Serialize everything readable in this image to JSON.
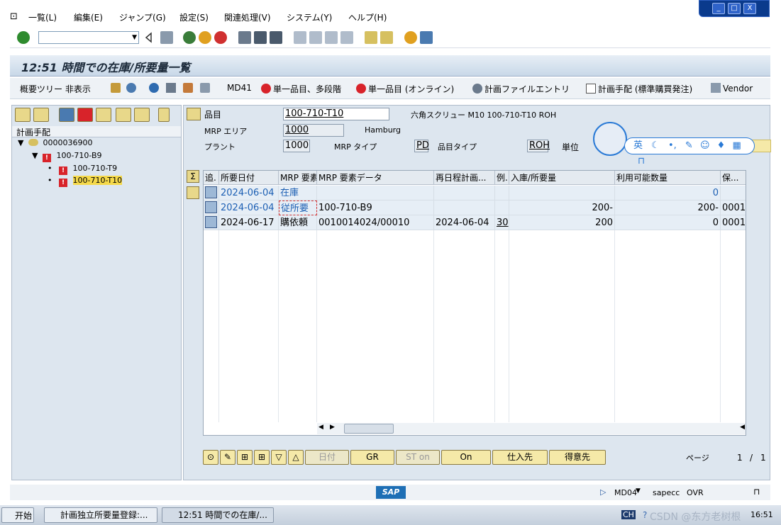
{
  "menubar": [
    "一覧(L)",
    "編集(E)",
    "ジャンプ(G)",
    "設定(S)",
    "関連処理(V)",
    "システム(Y)",
    "ヘルプ(H)"
  ],
  "window_buttons": [
    "_",
    "□",
    "X"
  ],
  "screen_title": "12:51 時間での在庫/所要量一覧",
  "appbar": {
    "hide_tree": "概要ツリー 非表示",
    "md41": "MD41",
    "single_multi": "単一品目、多段階",
    "single_online": "単一品目 (オンライン)",
    "planning_file": "計画ファイルエントリ",
    "planning_std": "計画手配 (標準購買発注)",
    "vendor": "Vendor"
  },
  "tree": {
    "header": "計画手配",
    "nodes": [
      {
        "label": "0000036900",
        "level": 0
      },
      {
        "label": "100-710-B9",
        "level": 1
      },
      {
        "label": "100-710-T9",
        "level": 2
      },
      {
        "label": "100-710-T10",
        "level": 2,
        "selected": true
      }
    ]
  },
  "header": {
    "material_label": "品目",
    "material_value": "100-710-T10",
    "material_desc": "六角スクリュー M10 100-710-T10 ROH",
    "mrp_area_label": "MRP エリア",
    "mrp_area_value": "1000",
    "mrp_area_desc": "Hamburg",
    "plant_label": "プラント",
    "plant_value": "1000",
    "mrp_type_label": "MRP タイプ",
    "mrp_type_value": "PD",
    "material_type_label": "品目タイプ",
    "material_type_value": "ROH",
    "unit_label": "単位"
  },
  "grid": {
    "columns": [
      "追.",
      "所要日付",
      "MRP 要素",
      "MRP 要素データ",
      "再日程計画...",
      "例.",
      "入庫/所要量",
      "利用可能数量",
      "保..."
    ],
    "rows": [
      {
        "date": "2024-06-04",
        "element": "在庫",
        "data": "",
        "resched": "",
        "exc": "",
        "qty": "",
        "avail": "0",
        "sloc": "",
        "blue": true
      },
      {
        "date": "2024-06-04",
        "element": "従所要",
        "data": "100-710-B9",
        "resched": "",
        "exc": "",
        "qty": "200-",
        "avail": "200-",
        "sloc": "0001",
        "blue": true
      },
      {
        "date": "2024-06-17",
        "element": "購依頼",
        "data": "0010014024/00010",
        "resched": "2024-06-04",
        "exc": "30",
        "qty": "200",
        "avail": "0",
        "sloc": "0001",
        "blue": false
      }
    ]
  },
  "bottom_buttons": {
    "date": "日付",
    "gr": "GR",
    "st_on": "ST on",
    "on": "On",
    "vendor": "仕入先",
    "customer": "得意先"
  },
  "paging": {
    "label": "ページ",
    "current": "1",
    "sep": "/",
    "total": "1"
  },
  "status": {
    "transaction": "MD04",
    "system": "sapecc",
    "mode": "OVR",
    "logo": "SAP"
  },
  "ime": {
    "lang": "英"
  },
  "taskbar": {
    "start": "开始",
    "tasks": [
      "計画独立所要量登録:...",
      "12:51 時間での在庫/..."
    ],
    "lang": "CH",
    "time": "16:51",
    "watermark": "CSDN @东方老树根"
  },
  "colors": {
    "accent": "#1c5fb3",
    "button": "#f5e9a8",
    "panel": "#dde6ef"
  }
}
